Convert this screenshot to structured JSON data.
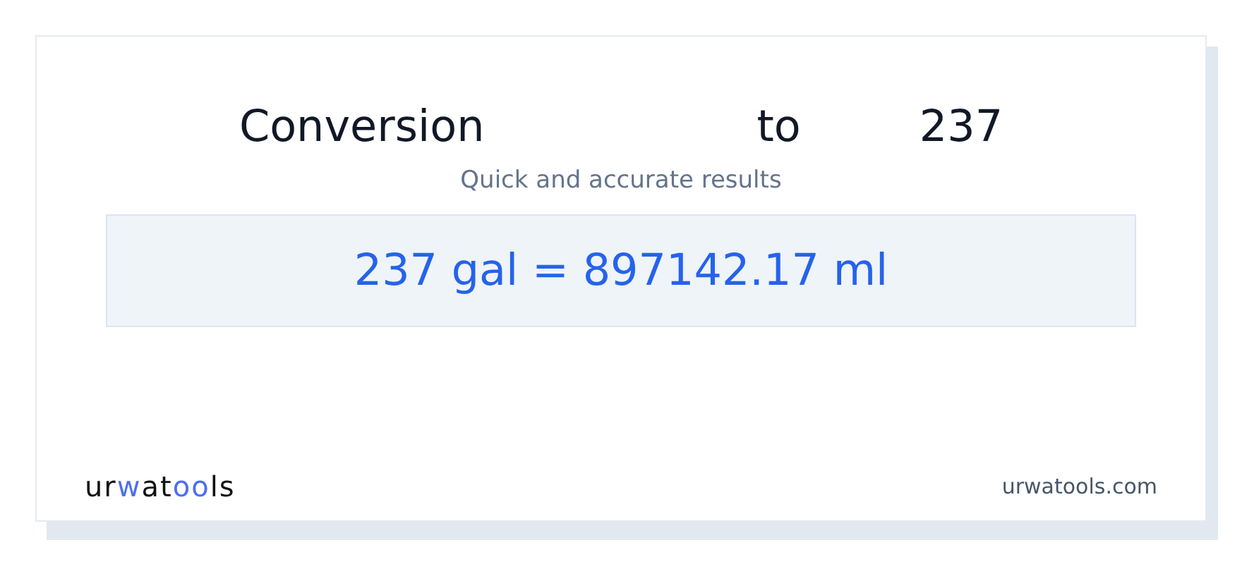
{
  "title_words": [
    "Conversion",
    "to",
    "237"
  ],
  "subtitle": "Quick and accurate results",
  "result": "237 gal = 897142.17 ml",
  "footer": {
    "logo": [
      {
        "text": "ur",
        "accent": false
      },
      {
        "text": "w",
        "accent": true
      },
      {
        "text": "at",
        "accent": false
      },
      {
        "text": "oo",
        "accent": true
      },
      {
        "text": "ls",
        "accent": false
      }
    ],
    "domain": "urwatools.com"
  }
}
